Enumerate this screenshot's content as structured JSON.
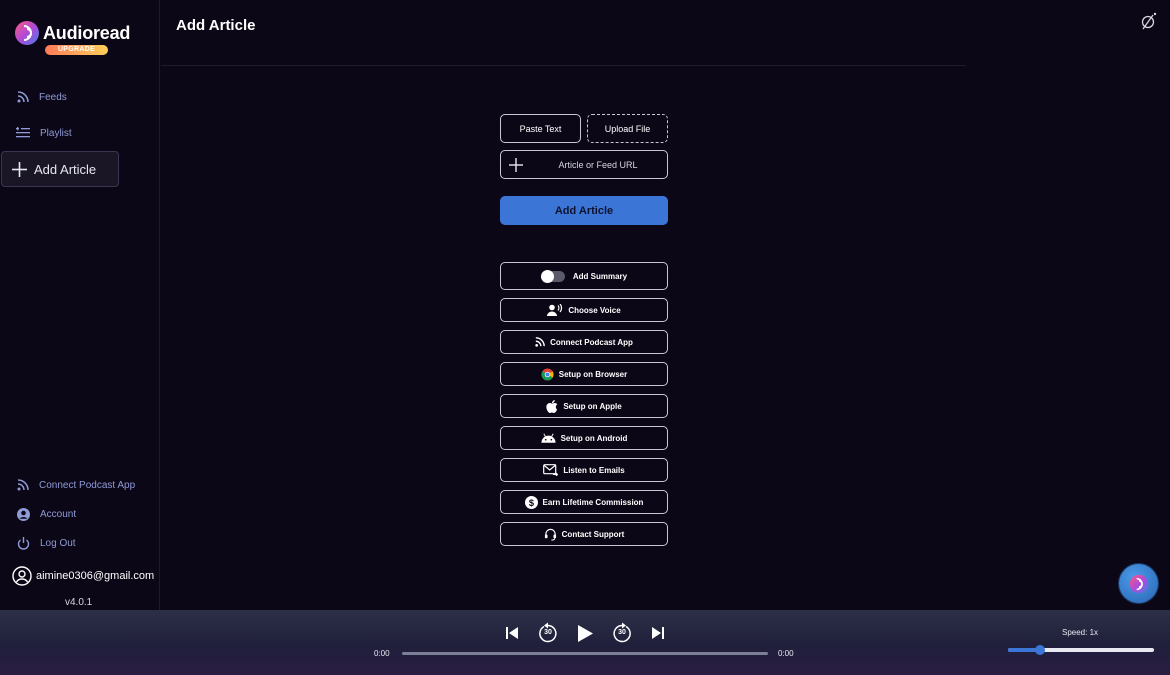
{
  "brand": {
    "name": "Audioread",
    "badge": "UPGRADE"
  },
  "sidebar": {
    "items": [
      {
        "label": "Feeds",
        "icon": "rss-icon"
      },
      {
        "label": "Playlist",
        "icon": "playlist-icon"
      },
      {
        "label": "Add Article",
        "icon": "plus-icon",
        "active": true
      }
    ],
    "bottom_items": [
      {
        "label": "Connect Podcast App",
        "icon": "rss-icon"
      },
      {
        "label": "Account",
        "icon": "account-icon"
      },
      {
        "label": "Log Out",
        "icon": "power-icon"
      }
    ],
    "user_email": "aimine0306@gmail.com",
    "version": "v4.0.1"
  },
  "header": {
    "title": "Add Article"
  },
  "form": {
    "paste_label": "Paste Text",
    "upload_label": "Upload File",
    "url_placeholder": "Article or Feed URL",
    "url_value": "",
    "submit_label": "Add Article"
  },
  "options": [
    {
      "label": "Add Summary",
      "icon": "toggle-switch",
      "toggle_on": false
    },
    {
      "label": "Choose Voice",
      "icon": "voice-icon"
    },
    {
      "label": "Connect Podcast App",
      "icon": "rss-icon"
    },
    {
      "label": "Setup on Browser",
      "icon": "chrome-icon"
    },
    {
      "label": "Setup on Apple",
      "icon": "apple-icon"
    },
    {
      "label": "Setup on Android",
      "icon": "android-icon"
    },
    {
      "label": "Listen to Emails",
      "icon": "email-icon"
    },
    {
      "label": "Earn Lifetime Commission",
      "icon": "dollar-icon"
    },
    {
      "label": "Contact Support",
      "icon": "headset-icon"
    }
  ],
  "player": {
    "current_time": "0:00",
    "duration": "0:00",
    "progress": 0,
    "skip_back_seconds": "30",
    "skip_forward_seconds": "30",
    "speed_label": "Speed: 1x",
    "speed_fraction": 0.22
  },
  "colors": {
    "background": "#0b0716",
    "accent": "#3b76d6",
    "nav_text": "#8f9ad6",
    "badge_gradient_start": "#ff7a59",
    "badge_gradient_end": "#ffcf5a"
  }
}
